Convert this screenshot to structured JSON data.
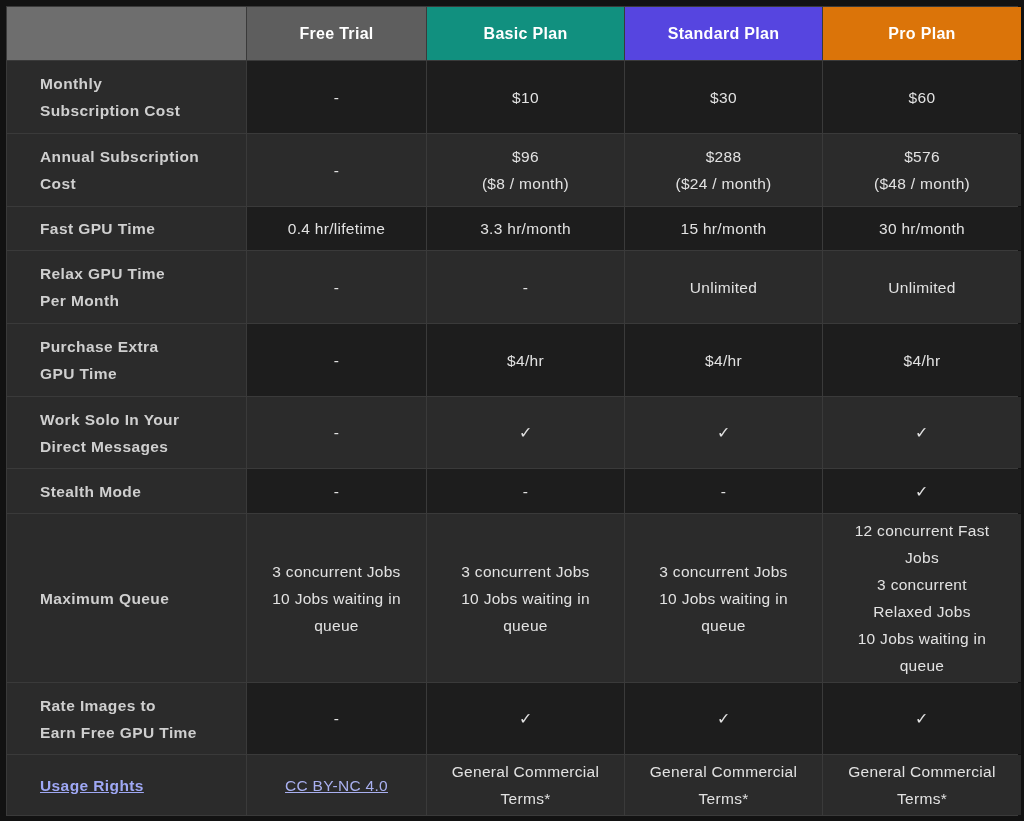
{
  "header": [
    {
      "color": "#6e6e6e"
    },
    {
      "label": "Free Trial",
      "color": "#5e5e5e"
    },
    {
      "label": "Basic Plan",
      "color": "#11907f"
    },
    {
      "label": "Standard Plan",
      "color": "#5645e0"
    },
    {
      "label": "Pro Plan",
      "color": "#db7409"
    }
  ],
  "rows": [
    {
      "label": {
        "kind": "text",
        "lines": [
          "Monthly",
          "Subscription Cost"
        ]
      },
      "cells": [
        {
          "kind": "text",
          "lines": [
            "-"
          ]
        },
        {
          "kind": "text",
          "lines": [
            "$10"
          ]
        },
        {
          "kind": "text",
          "lines": [
            "$30"
          ]
        },
        {
          "kind": "text",
          "lines": [
            "$60"
          ]
        }
      ]
    },
    {
      "label": {
        "kind": "text",
        "lines": [
          "Annual Subscription",
          "Cost"
        ]
      },
      "cells": [
        {
          "kind": "text",
          "lines": [
            "-"
          ]
        },
        {
          "kind": "text",
          "lines": [
            "$96",
            "($8 / month)"
          ]
        },
        {
          "kind": "text",
          "lines": [
            "$288",
            "($24 / month)"
          ]
        },
        {
          "kind": "text",
          "lines": [
            "$576",
            "($48 / month)"
          ]
        }
      ]
    },
    {
      "label": {
        "kind": "text",
        "lines": [
          "Fast GPU Time"
        ]
      },
      "cells": [
        {
          "kind": "text",
          "lines": [
            "0.4 hr/lifetime"
          ]
        },
        {
          "kind": "text",
          "lines": [
            "3.3 hr/month"
          ]
        },
        {
          "kind": "text",
          "lines": [
            "15 hr/month"
          ]
        },
        {
          "kind": "text",
          "lines": [
            "30 hr/month"
          ]
        }
      ]
    },
    {
      "label": {
        "kind": "text",
        "lines": [
          "Relax GPU Time",
          "Per Month"
        ]
      },
      "cells": [
        {
          "kind": "text",
          "lines": [
            "-"
          ]
        },
        {
          "kind": "text",
          "lines": [
            "-"
          ]
        },
        {
          "kind": "text",
          "lines": [
            "Unlimited"
          ]
        },
        {
          "kind": "text",
          "lines": [
            "Unlimited"
          ]
        }
      ]
    },
    {
      "label": {
        "kind": "text",
        "lines": [
          "Purchase Extra",
          "GPU Time"
        ]
      },
      "cells": [
        {
          "kind": "text",
          "lines": [
            "-"
          ]
        },
        {
          "kind": "text",
          "lines": [
            "$4/hr"
          ]
        },
        {
          "kind": "text",
          "lines": [
            "$4/hr"
          ]
        },
        {
          "kind": "text",
          "lines": [
            "$4/hr"
          ]
        }
      ]
    },
    {
      "label": {
        "kind": "text",
        "lines": [
          "Work Solo In Your",
          "Direct Messages"
        ]
      },
      "cells": [
        {
          "kind": "text",
          "lines": [
            "-"
          ]
        },
        {
          "kind": "text",
          "lines": [
            "✓"
          ]
        },
        {
          "kind": "text",
          "lines": [
            "✓"
          ]
        },
        {
          "kind": "text",
          "lines": [
            "✓"
          ]
        }
      ]
    },
    {
      "label": {
        "kind": "text",
        "lines": [
          "Stealth Mode"
        ]
      },
      "cells": [
        {
          "kind": "text",
          "lines": [
            "-"
          ]
        },
        {
          "kind": "text",
          "lines": [
            "-"
          ]
        },
        {
          "kind": "text",
          "lines": [
            "-"
          ]
        },
        {
          "kind": "text",
          "lines": [
            "✓"
          ]
        }
      ]
    },
    {
      "label": {
        "kind": "text",
        "lines": [
          "Maximum Queue"
        ]
      },
      "cells": [
        {
          "kind": "text",
          "lines": [
            "3 concurrent Jobs",
            "10 Jobs waiting in",
            "queue"
          ]
        },
        {
          "kind": "text",
          "lines": [
            "3 concurrent Jobs",
            "10 Jobs waiting in",
            "queue"
          ]
        },
        {
          "kind": "text",
          "lines": [
            "3 concurrent Jobs",
            "10 Jobs waiting in",
            "queue"
          ]
        },
        {
          "kind": "text",
          "lines": [
            "12 concurrent Fast",
            "Jobs",
            "3 concurrent",
            "Relaxed Jobs",
            "10 Jobs waiting in",
            "queue"
          ]
        }
      ]
    },
    {
      "label": {
        "kind": "text",
        "lines": [
          "Rate Images to",
          "Earn Free GPU Time"
        ]
      },
      "cells": [
        {
          "kind": "text",
          "lines": [
            "-"
          ]
        },
        {
          "kind": "text",
          "lines": [
            "✓"
          ]
        },
        {
          "kind": "text",
          "lines": [
            "✓"
          ]
        },
        {
          "kind": "text",
          "lines": [
            "✓"
          ]
        }
      ]
    },
    {
      "label": {
        "kind": "link",
        "lines": [
          "Usage Rights"
        ]
      },
      "cells": [
        {
          "kind": "link",
          "lines": [
            "CC BY-NC 4.0"
          ]
        },
        {
          "kind": "text",
          "lines": [
            "General Commercial",
            "Terms*"
          ]
        },
        {
          "kind": "text",
          "lines": [
            "General Commercial",
            "Terms*"
          ]
        },
        {
          "kind": "text",
          "lines": [
            "General Commercial",
            "Terms*"
          ]
        }
      ]
    }
  ]
}
